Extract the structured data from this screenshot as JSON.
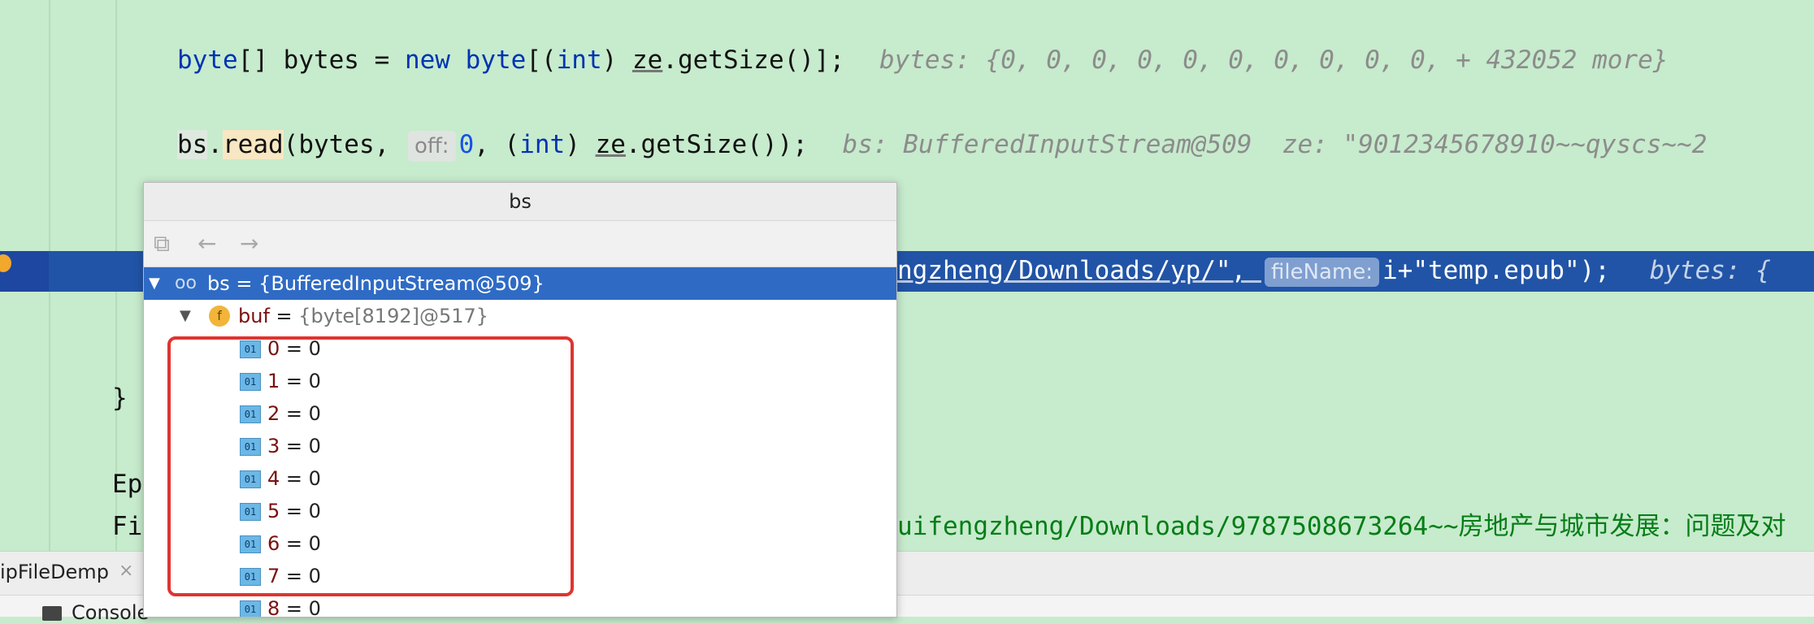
{
  "editor": {
    "line1": {
      "kw_byte": "byte",
      "brackets": "[] ",
      "var_bytes": "bytes",
      "eq": " = ",
      "kw_new": "new",
      "kw_byte2": "byte",
      "open": "[(",
      "kw_int": "int",
      "close_paren": ") ",
      "ze": "ze",
      "getsize": ".getSize()];",
      "inline": "bytes: {0, 0, 0, 0, 0, 0, 0, 0, 0, 0, + 432052 more}"
    },
    "line2": {
      "bs": "bs",
      "dot": ".",
      "read": "read",
      "args1": "(bytes, ",
      "hint_off": "off:",
      "zero": "0",
      "args2": ", (",
      "kw_int": "int",
      "close_paren": ") ",
      "ze": "ze",
      "getsize": ".getSize());",
      "inline": "bs: BufferedInputStream@509  ze: \"9012345678910~~qyscs~~2"
    },
    "current_line": {
      "text_before": "ngzheng/Downloads/yp/\", ",
      "hint_filename": "fileName:",
      "text_after": "i+\"temp.epub\");",
      "inline": "bytes: {"
    },
    "closing_brace": "}",
    "line_ep": "Ep",
    "line_fi": "Fi",
    "line_fi_rest": "uifengzheng/Downloads/9787508673264~~房地产与城市发展：问题及对"
  },
  "bottom": {
    "run_tab": "ipFileDemp",
    "close": "×",
    "console": "Console"
  },
  "popup": {
    "title": "bs",
    "toolbar": {
      "icon1": "⧉",
      "back": "←",
      "forward": "→"
    },
    "root": {
      "name": "bs",
      "eq": " = ",
      "value": "{BufferedInputStream@509}"
    },
    "child": {
      "badge": "f",
      "name": "buf",
      "eq": " = ",
      "value": "{byte[8192]@517}"
    },
    "elements": [
      {
        "index": "0",
        "value": "0"
      },
      {
        "index": "1",
        "value": "0"
      },
      {
        "index": "2",
        "value": "0"
      },
      {
        "index": "3",
        "value": "0"
      },
      {
        "index": "4",
        "value": "0"
      },
      {
        "index": "5",
        "value": "0"
      },
      {
        "index": "6",
        "value": "0"
      },
      {
        "index": "7",
        "value": "0"
      },
      {
        "index": "8",
        "value": "0"
      }
    ],
    "prim_badge": "01"
  },
  "colors": {
    "editor_bg": "#c7ebcd",
    "current_line": "#2154a6",
    "selection": "#2f6bc5",
    "highlight_box": "#e0342f"
  }
}
